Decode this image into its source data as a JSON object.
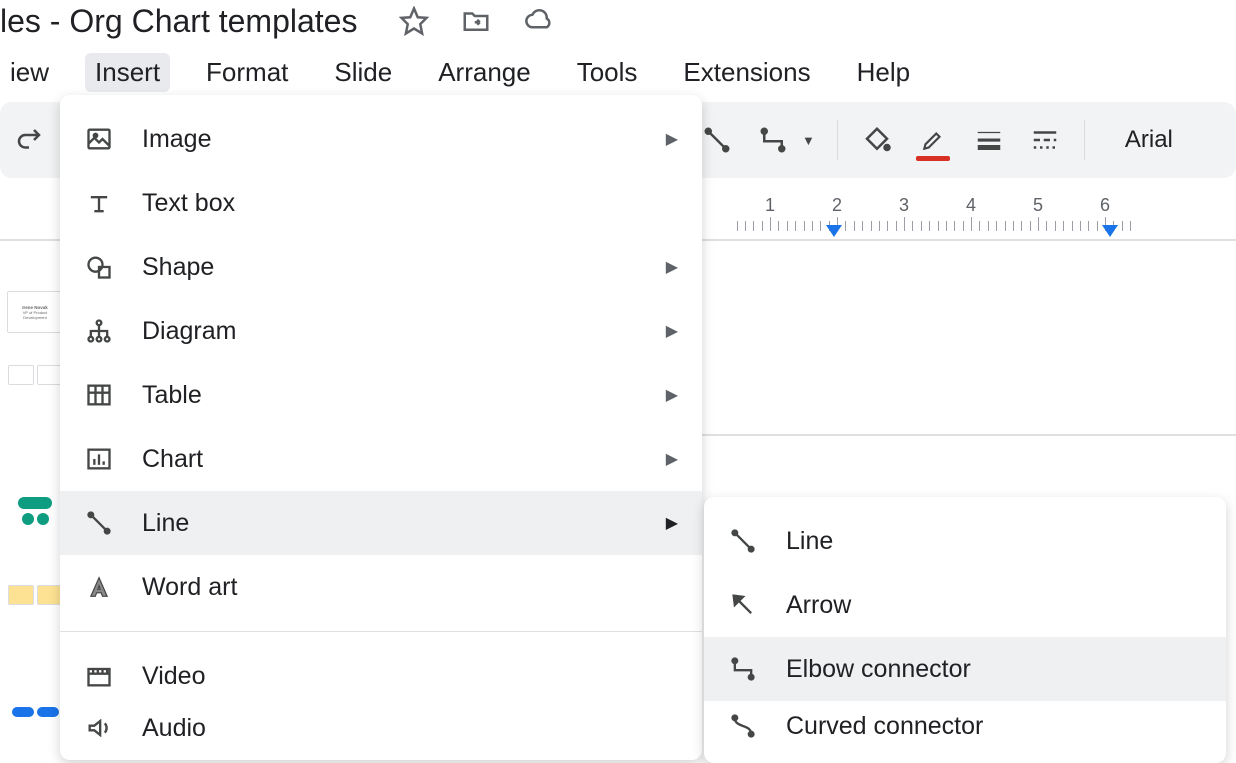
{
  "doc": {
    "title_visible": "les - Org Chart templates"
  },
  "menubar": {
    "view": "iew",
    "insert": "Insert",
    "format": "Format",
    "slide": "Slide",
    "arrange": "Arrange",
    "tools": "Tools",
    "extensions": "Extensions",
    "help": "Help"
  },
  "toolbar": {
    "font": "Arial"
  },
  "ruler": {
    "start_index": 1,
    "count": 6,
    "marker_left_tick": 1.95,
    "marker_right_tick": 6.08
  },
  "insertmenu": {
    "image": "Image",
    "textbox": "Text box",
    "shape": "Shape",
    "diagram": "Diagram",
    "table": "Table",
    "chart": "Chart",
    "line": "Line",
    "wordart": "Word art",
    "video": "Video",
    "audio": "Audio"
  },
  "linemenu": {
    "line": "Line",
    "arrow": "Arrow",
    "elbow": "Elbow connector",
    "curved": "Curved connector"
  },
  "thumbs": {
    "name1": "Irene Novak",
    "role1": "VP of Product",
    "role1b": "Development"
  }
}
